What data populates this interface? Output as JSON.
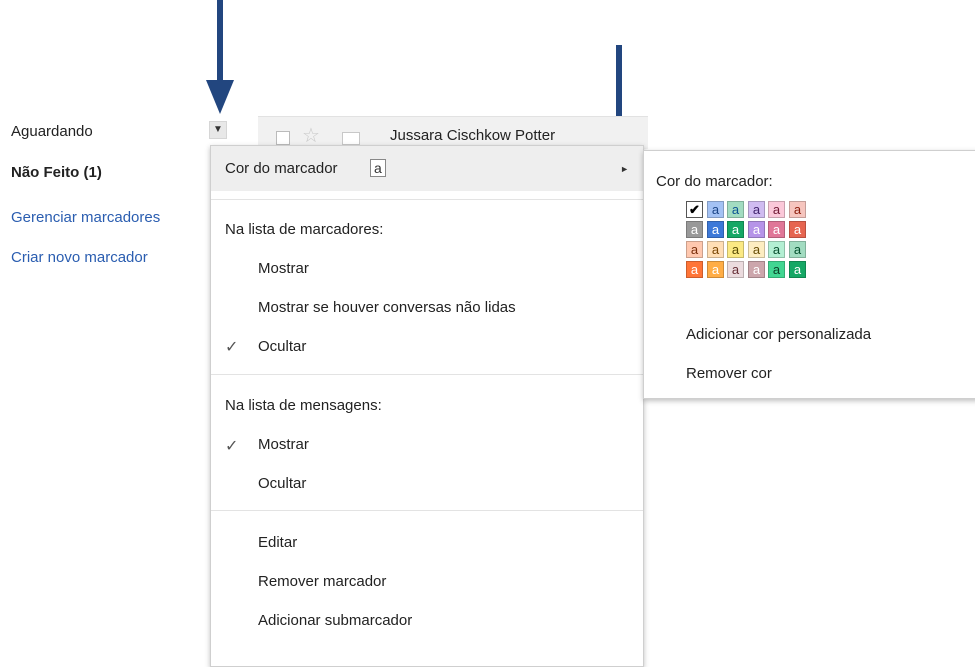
{
  "sidebar": {
    "aguardando": "Aguardando",
    "nao_feito": "Não Feito (1)",
    "gerenciar": "Gerenciar marcadores",
    "criar": "Criar novo marcador",
    "toggle_glyph": "▼"
  },
  "mail_row": {
    "sender": "Jussara Cischkow Potter",
    "star_glyph": "☆"
  },
  "menu": {
    "label_color": "Cor do marcador",
    "sample_letter": "a",
    "submenu_glyph": "►",
    "section_labels_list": "Na lista de marcadores:",
    "show": "Mostrar",
    "show_if_unread": "Mostrar se houver conversas não lidas",
    "hide": "Ocultar",
    "section_messages_list": "Na lista de mensagens:",
    "msg_show": "Mostrar",
    "msg_hide": "Ocultar",
    "edit": "Editar",
    "remove_label": "Remover marcador",
    "add_sublabel": "Adicionar submarcador",
    "check_glyph": "✓"
  },
  "color_menu": {
    "title": "Cor do marcador:",
    "custom": "Adicionar cor personalizada",
    "remove": "Remover cor",
    "check_glyph": "✔",
    "letter": "a",
    "rows": [
      [
        {
          "bg": "#ffffff",
          "fg": "#000000",
          "checked": true
        },
        {
          "bg": "#a4c2f4",
          "fg": "#1c4587"
        },
        {
          "bg": "#a2dcc1",
          "fg": "#0b5394"
        },
        {
          "bg": "#d0bcf1",
          "fg": "#41236d"
        },
        {
          "bg": "#fbc8d9",
          "fg": "#711a36"
        },
        {
          "bg": "#f6c5be",
          "fg": "#8a1c0a"
        }
      ],
      [
        {
          "bg": "#999999",
          "fg": "#ffffff"
        },
        {
          "bg": "#3c78d8",
          "fg": "#ffffff"
        },
        {
          "bg": "#16a765",
          "fg": "#ffffff"
        },
        {
          "bg": "#b694e8",
          "fg": "#ffffff"
        },
        {
          "bg": "#e07798",
          "fg": "#ffffff"
        },
        {
          "bg": "#e66550",
          "fg": "#ffffff"
        }
      ],
      [
        {
          "bg": "#ffc8af",
          "fg": "#7a2e0b"
        },
        {
          "bg": "#ffdeb5",
          "fg": "#7a4706"
        },
        {
          "bg": "#fbe983",
          "fg": "#594c05"
        },
        {
          "bg": "#fdedc1",
          "fg": "#684e07"
        },
        {
          "bg": "#b3efd3",
          "fg": "#0b4f30"
        },
        {
          "bg": "#a2dcc1",
          "fg": "#04502e"
        }
      ],
      [
        {
          "bg": "#ff7537",
          "fg": "#ffffff"
        },
        {
          "bg": "#ffad46",
          "fg": "#ffffff"
        },
        {
          "bg": "#ebdbde",
          "fg": "#662e37"
        },
        {
          "bg": "#cca6ac",
          "fg": "#ffffff"
        },
        {
          "bg": "#42d692",
          "fg": "#094228"
        },
        {
          "bg": "#16a765",
          "fg": "#ffffff"
        }
      ]
    ]
  },
  "colors": {
    "arrow": "#22467f",
    "link": "#2a5db0"
  }
}
